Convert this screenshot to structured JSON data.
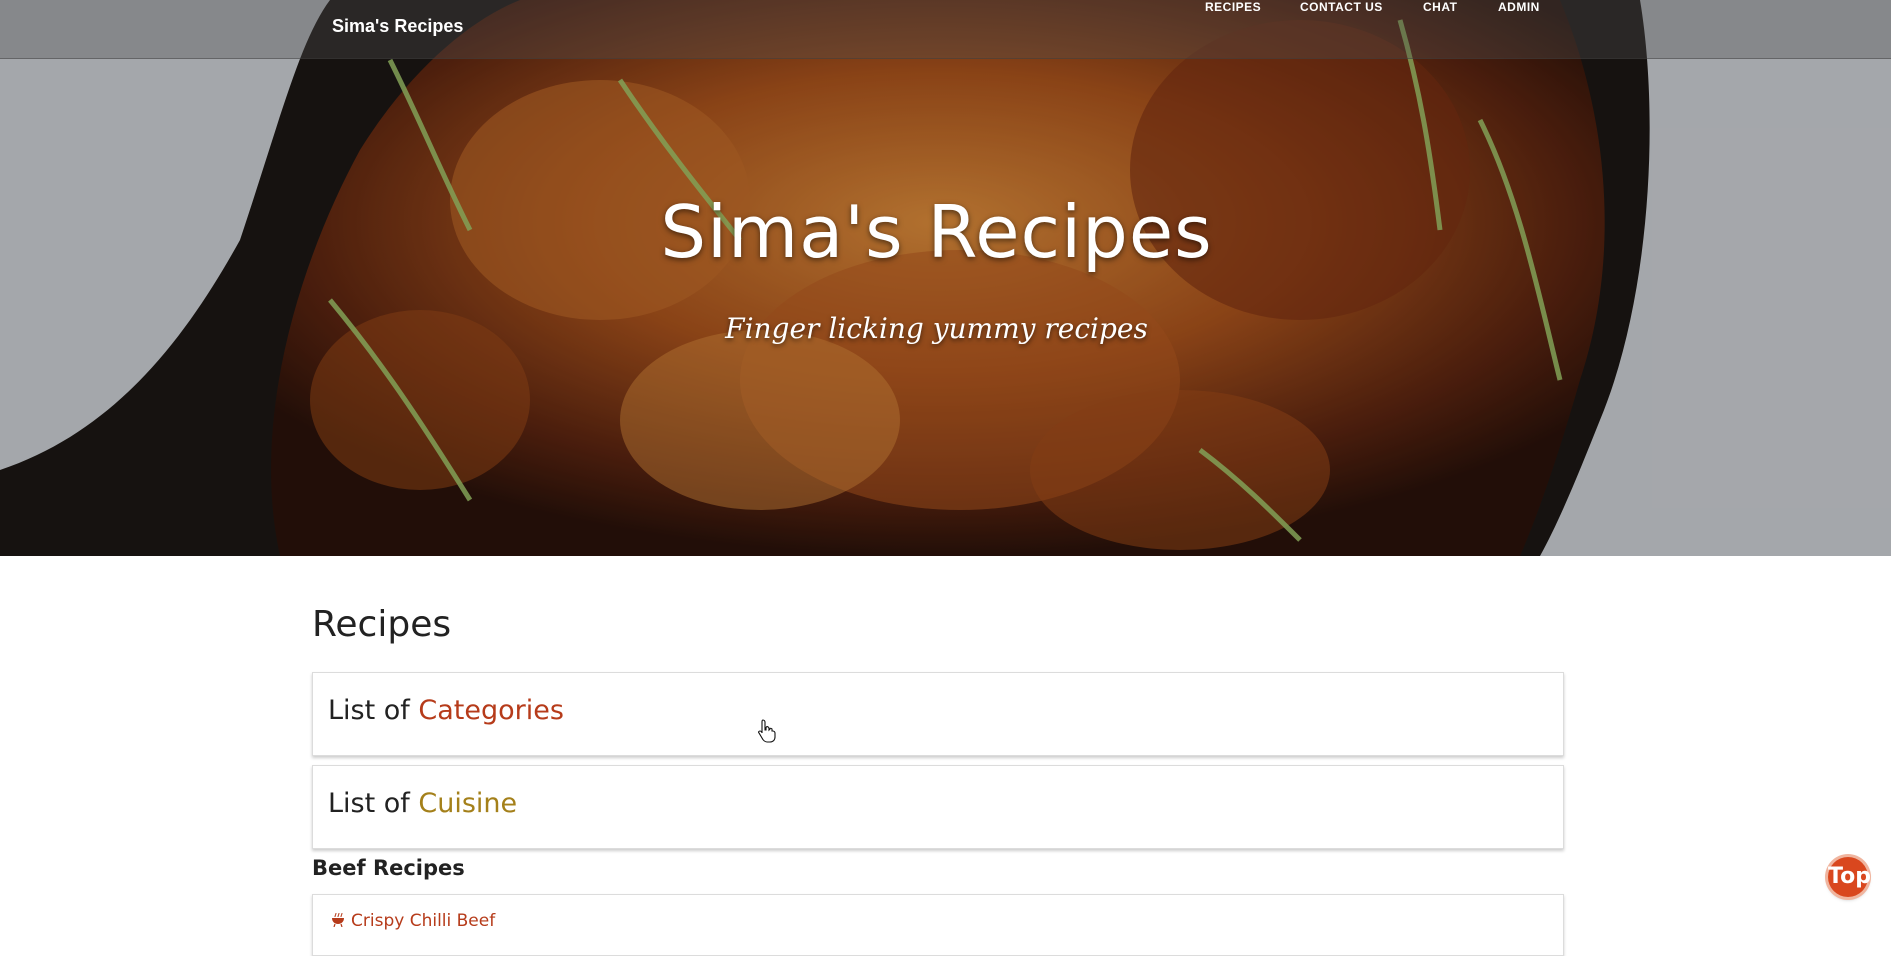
{
  "site": {
    "brand": "Sima's Recipes",
    "nav": [
      "RECIPES",
      "CONTACT US",
      "CHAT",
      "ADMIN"
    ]
  },
  "hero": {
    "title": "Sima's Recipes",
    "subtitle": "Finger licking yummy recipes"
  },
  "main": {
    "title": "Recipes",
    "panels": [
      {
        "prefix": "List of ",
        "highlight": "Categories"
      },
      {
        "prefix": "List of ",
        "highlight": "Cuisine"
      }
    ],
    "section": "Beef Recipes",
    "recipes": [
      "Crispy Chilli Beef"
    ]
  },
  "top_button": "Top",
  "colors": {
    "accent_categories": "#b63b1a",
    "accent_cuisine": "#a4801a",
    "top_button": "#d9471e"
  },
  "icons": [
    "hand-pointer-icon",
    "grill-icon"
  ]
}
